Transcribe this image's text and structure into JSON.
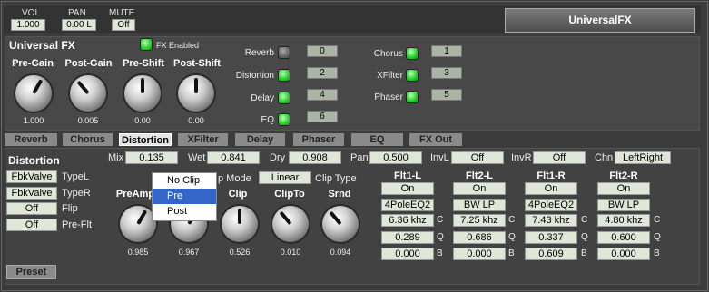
{
  "header": {
    "vol_label": "VOL",
    "vol_value": "1.000",
    "pan_label": "PAN",
    "pan_value": "0.00 L",
    "mute_label": "MUTE",
    "mute_value": "Off",
    "plugin_name": "UniversalFX"
  },
  "universal": {
    "title": "Universal FX",
    "fx_enabled_label": "FX Enabled",
    "knobs": [
      {
        "label": "Pre-Gain",
        "value": "1.000"
      },
      {
        "label": "Post-Gain",
        "value": "0.005"
      },
      {
        "label": "Pre-Shift",
        "value": "0.00"
      },
      {
        "label": "Post-Shift",
        "value": "0.00"
      }
    ]
  },
  "chain_left": [
    {
      "label": "Reverb",
      "on": false,
      "order": "0"
    },
    {
      "label": "Distortion",
      "on": true,
      "order": "2"
    },
    {
      "label": "Delay",
      "on": true,
      "order": "4"
    },
    {
      "label": "EQ",
      "on": true,
      "order": "6"
    }
  ],
  "chain_right": [
    {
      "label": "Chorus",
      "on": true,
      "order": "1"
    },
    {
      "label": "XFilter",
      "on": true,
      "order": "3"
    },
    {
      "label": "Phaser",
      "on": true,
      "order": "5"
    }
  ],
  "tabs": [
    "Reverb",
    "Chorus",
    "Distortion",
    "XFilter",
    "Delay",
    "Phaser",
    "EQ",
    "FX Out"
  ],
  "active_tab": "Distortion",
  "params": {
    "mix_label": "Mix",
    "mix": "0.135",
    "wet_label": "Wet",
    "wet": "0.841",
    "dry_label": "Dry",
    "dry": "0.908",
    "pan_label": "Pan",
    "pan": "0.500",
    "invl_label": "InvL",
    "invl": "Off",
    "invr_label": "InvR",
    "invr": "Off",
    "chn_label": "Chn",
    "chn": "LeftRight"
  },
  "distortion": {
    "title": "Distortion",
    "typel_value": "FbkValve",
    "typel_label": "TypeL",
    "typer_value": "FbkValve",
    "typer_label": "TypeR",
    "flip_value": "Off",
    "flip_label": "Flip",
    "preflt_value": "Off",
    "preflt_label": "Pre-Flt",
    "mode_label": "p Mode",
    "clip_type_value": "Linear",
    "clip_type_label": "Clip Type",
    "knobs": [
      {
        "label": "PreAmp",
        "value": "0.985"
      },
      {
        "label": "",
        "value": "0.967"
      },
      {
        "label": "Clip",
        "value": "0.526"
      },
      {
        "label": "ClipTo",
        "value": "0.010"
      },
      {
        "label": "Srnd",
        "value": "0.094"
      }
    ],
    "dropdown": {
      "options": [
        "No Clip",
        "Pre",
        "Post"
      ],
      "selected": "Pre"
    }
  },
  "filters": [
    {
      "title": "Flt1-L",
      "state": "On",
      "type": "4PoleEQ2",
      "freq": "6.36 khz",
      "q": "0.289",
      "b": "0.000"
    },
    {
      "title": "Flt2-L",
      "state": "On",
      "type": "BW LP",
      "freq": "7.25 khz",
      "q": "0.686",
      "b": "0.000"
    },
    {
      "title": "Flt1-R",
      "state": "On",
      "type": "4PoleEQ2",
      "freq": "7.43 khz",
      "q": "0.337",
      "b": "0.609"
    },
    {
      "title": "Flt2-R",
      "state": "On",
      "type": "BW LP",
      "freq": "4.80 khz",
      "q": "0.600",
      "b": "0.000"
    }
  ],
  "filter_letters": {
    "c": "C",
    "q": "Q",
    "b": "B"
  },
  "preset_label": "Preset"
}
